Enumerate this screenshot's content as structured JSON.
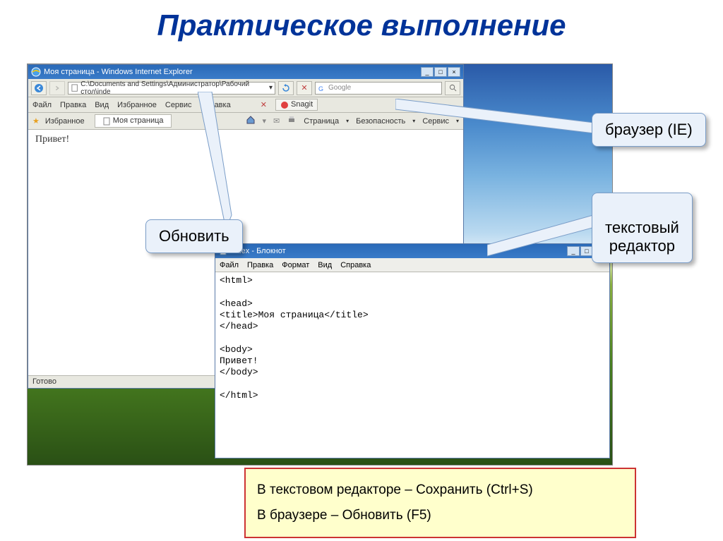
{
  "slide": {
    "title": "Практическое выполнение"
  },
  "ie": {
    "title": "Моя страница - Windows Internet Explorer",
    "address": "C:\\Documents and Settings\\Администратор\\Рабочий стол\\inde",
    "search_placeholder": "Google",
    "menu": [
      "Файл",
      "Правка",
      "Вид",
      "Избранное",
      "Сервис",
      "Справка"
    ],
    "snagit": "Snagit",
    "fav_label": "Избранное",
    "tab_label": "Моя страница",
    "toolbar_items": [
      "Страница",
      "Безопасность",
      "Сервис"
    ],
    "content": "Привет!",
    "status": "Готово"
  },
  "notepad": {
    "title": "index - Блокнот",
    "menu": [
      "Файл",
      "Правка",
      "Формат",
      "Вид",
      "Справка"
    ],
    "content": "<html>\n\n<head>\n<title>Моя страница</title>\n</head>\n\n<body>\nПривет!\n</body>\n\n</html>"
  },
  "callouts": {
    "refresh": "Обновить",
    "browser": "браузер (IE)",
    "editor": "текстовый\nредактор"
  },
  "instructions": {
    "line1": "В текстовом редакторе – Сохранить (Ctrl+S)",
    "line2": "В браузере – Обновить (F5)"
  }
}
